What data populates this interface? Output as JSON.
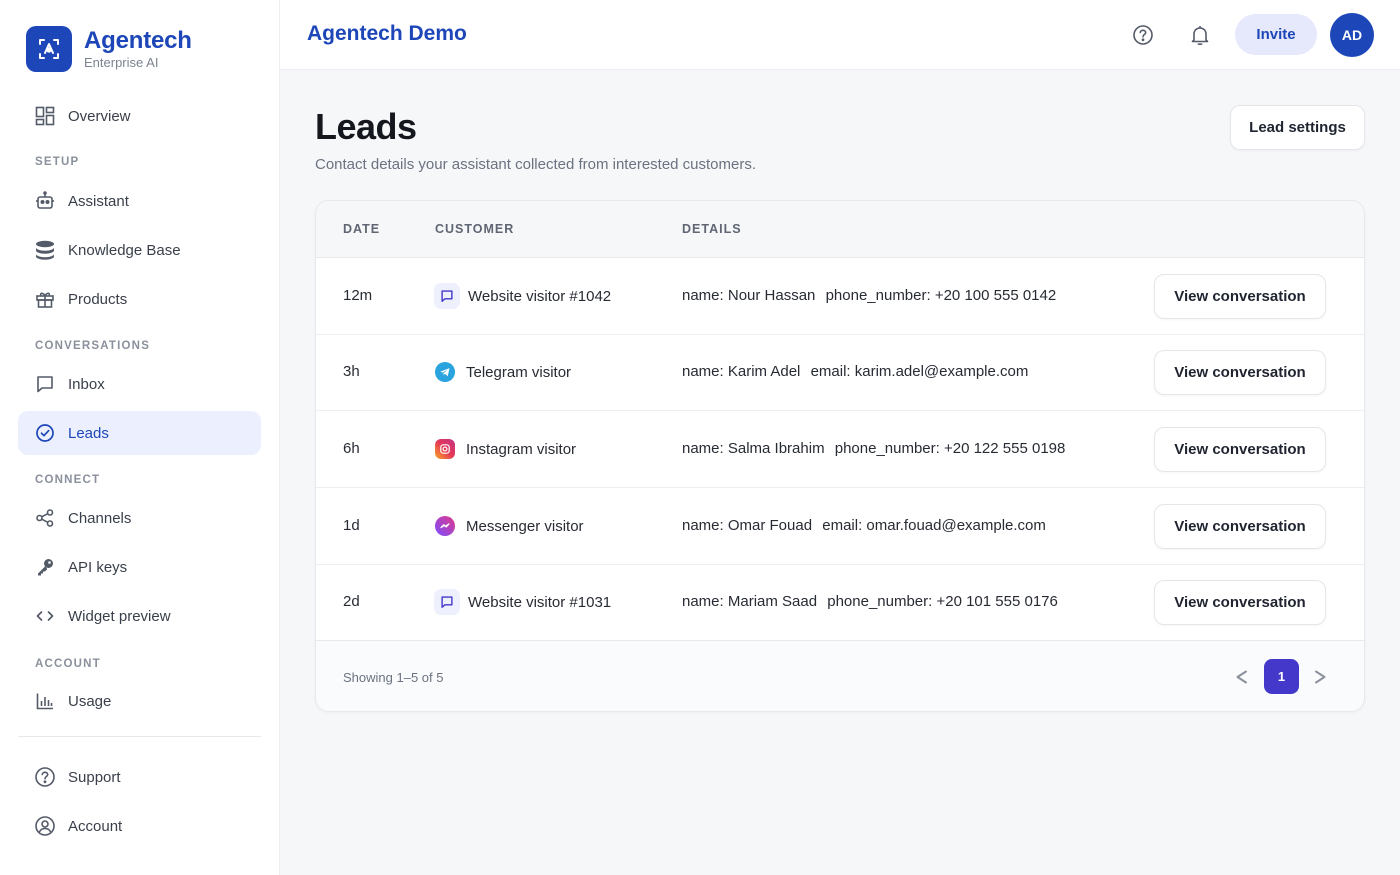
{
  "brand": {
    "name": "Agentech",
    "subtitle": "Enterprise AI"
  },
  "sidebar": {
    "sections": {
      "setup": "SETUP",
      "conversations": "CONVERSATIONS",
      "connect": "CONNECT",
      "account": "ACCOUNT"
    },
    "items": {
      "overview": "Overview",
      "assistant": "Assistant",
      "knowledge_base": "Knowledge Base",
      "products": "Products",
      "inbox": "Inbox",
      "leads": "Leads",
      "channels": "Channels",
      "api_keys": "API keys",
      "widget_preview": "Widget preview",
      "usage": "Usage",
      "support": "Support",
      "account": "Account"
    },
    "active": "leads"
  },
  "header": {
    "title": "Agentech Demo",
    "invite_label": "Invite",
    "avatar_initials": "AD"
  },
  "page": {
    "title": "Leads",
    "subtitle": "Contact details your assistant collected from interested customers.",
    "settings_label": "Lead settings"
  },
  "table": {
    "columns": [
      "DATE",
      "CUSTOMER",
      "DETAILS"
    ],
    "action_label": "View conversation",
    "rows": [
      {
        "date": "12m",
        "channel": "website",
        "customer": "Website visitor #1042",
        "details": [
          "name: Nour Hassan",
          "phone_number: +20 100 555 0142"
        ]
      },
      {
        "date": "3h",
        "channel": "telegram",
        "customer": "Telegram visitor",
        "details": [
          "name: Karim Adel",
          "email: karim.adel@example.com"
        ]
      },
      {
        "date": "6h",
        "channel": "instagram",
        "customer": "Instagram visitor",
        "details": [
          "name: Salma Ibrahim",
          "phone_number: +20 122 555 0198"
        ]
      },
      {
        "date": "1d",
        "channel": "messenger",
        "customer": "Messenger visitor",
        "details": [
          "name: Omar Fouad",
          "email: omar.fouad@example.com"
        ]
      },
      {
        "date": "2d",
        "channel": "website",
        "customer": "Website visitor #1031",
        "details": [
          "name: Mariam Saad",
          "phone_number: +20 101 555 0176"
        ]
      }
    ],
    "footer": {
      "showing": "Showing 1–5 of 5",
      "current_page": "1"
    }
  },
  "colors": {
    "accent": "#1d47b8",
    "active_bg": "#eceffe",
    "page_button": "#4338ca",
    "telegram": "#2aa3df",
    "messenger": "#7b4dff"
  }
}
